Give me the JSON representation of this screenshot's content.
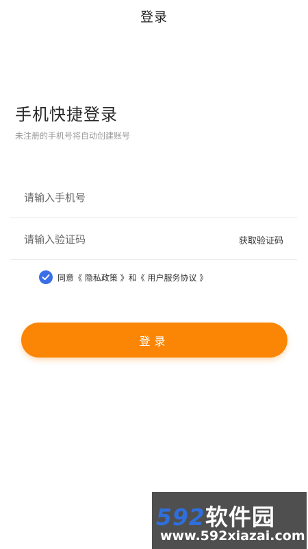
{
  "header": {
    "title": "登录"
  },
  "intro": {
    "title": "手机快捷登录",
    "subtitle": "未注册的手机号将自动创建账号"
  },
  "form": {
    "phone_placeholder": "请输入手机号",
    "code_placeholder": "请输入验证码",
    "get_code_label": "获取验证码"
  },
  "agreement": {
    "checked": true,
    "prefix": "同意",
    "privacy_link": "《 隐私政策 》",
    "joiner": "和",
    "service_link": "《 用户服务协议 》"
  },
  "login_button": {
    "label": "登录"
  },
  "watermark": {
    "number": "592",
    "brand": "软件园",
    "url": "www.592xiazai.com"
  },
  "colors": {
    "accent": "#fb8505",
    "checkbox": "#3a6ee8",
    "watermark_bg": "#4f4f4f",
    "watermark_number": "#2f6fdc"
  }
}
